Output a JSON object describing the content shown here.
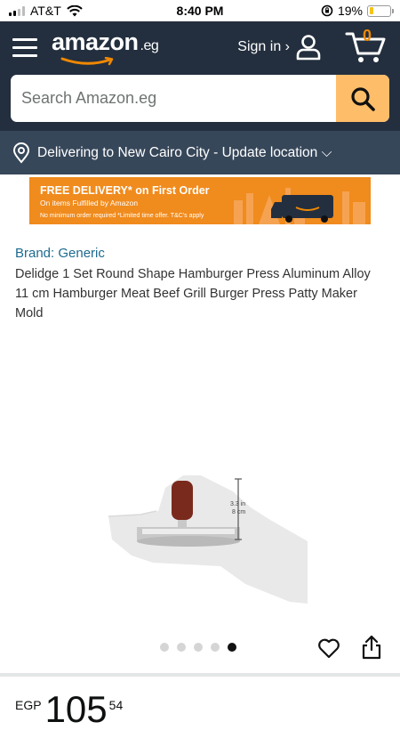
{
  "status_bar": {
    "carrier": "AT&T",
    "time": "8:40 PM",
    "battery": "19%",
    "battery_level": 0.19
  },
  "header": {
    "logo_text": "amazon",
    "logo_suffix": ".eg",
    "sign_in": "Sign in ›",
    "cart_count": "0"
  },
  "search": {
    "placeholder": "Search Amazon.eg"
  },
  "delivery": {
    "text": "Delivering to New Cairo City - Update location ⌵"
  },
  "banner": {
    "headline": "FREE DELIVERY* on First Order",
    "sub": "On items Fulfilled by Amazon",
    "fine": "No minimum order required *Limited time offer. T&C's apply"
  },
  "product": {
    "brand": "Brand: Generic",
    "title": "Delidge 1 Set Round Shape Hamburger Press Aluminum Alloy 11 cm Hamburger Meat Beef Grill Burger Press Patty Maker Mold",
    "image_dim_1": "3.3 in",
    "image_dim_2": "8 cm",
    "gallery_count": 5,
    "gallery_active": 5
  },
  "price": {
    "currency": "EGP",
    "whole": "105",
    "fraction": "54"
  },
  "colors": {
    "header_bg": "#232f3e",
    "delivery_bg": "#37475a",
    "search_btn": "#febd69",
    "banner_bg": "#f08b1d",
    "brand_link": "#1d6a8f"
  }
}
